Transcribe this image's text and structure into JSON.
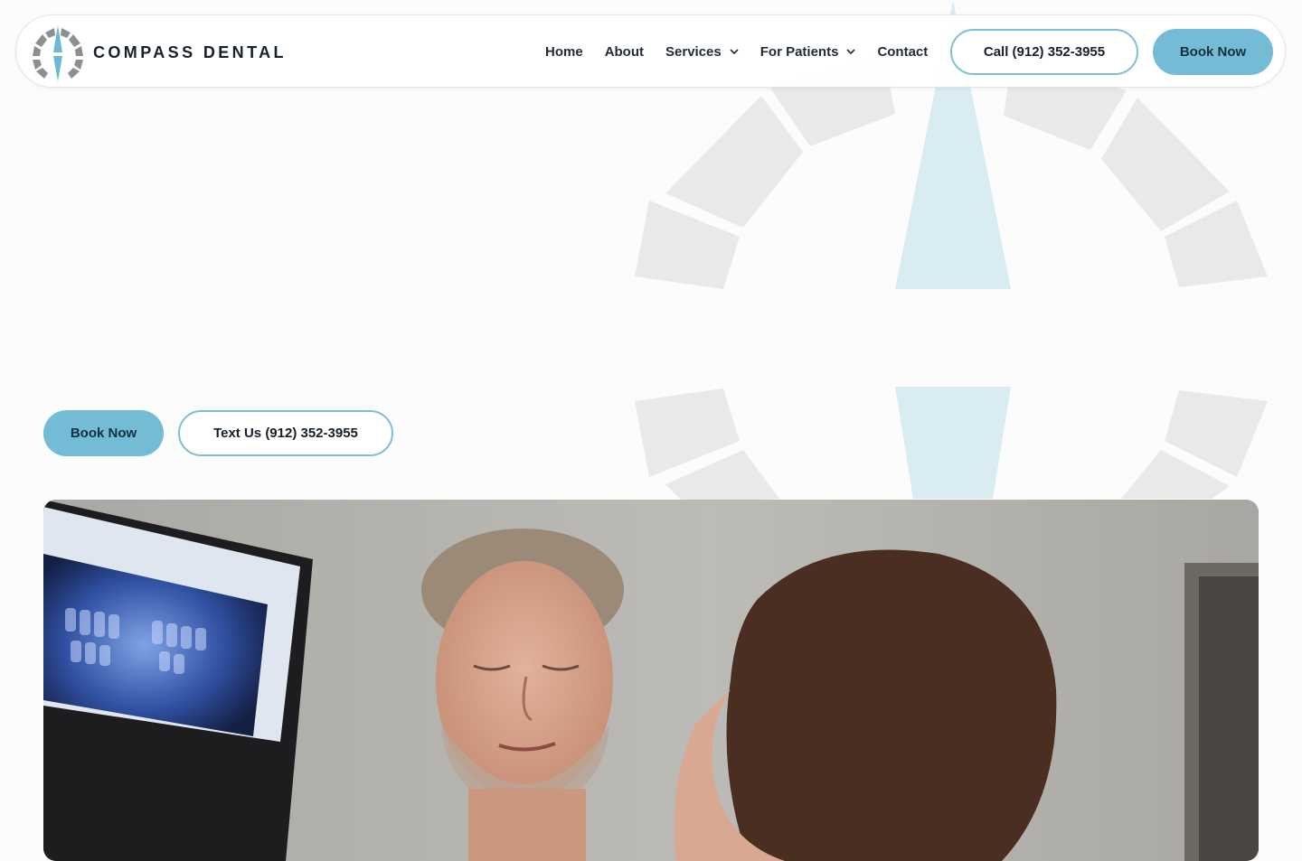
{
  "brand": {
    "name": "COMPASS DENTAL",
    "logo_icon": "compass-logo-icon"
  },
  "nav": {
    "items": [
      {
        "label": "Home",
        "has_dropdown": false
      },
      {
        "label": "About",
        "has_dropdown": false
      },
      {
        "label": "Services",
        "has_dropdown": true
      },
      {
        "label": "For Patients",
        "has_dropdown": true
      },
      {
        "label": "Contact",
        "has_dropdown": false
      }
    ],
    "call_label": "Call (912) 352-3955",
    "book_label": "Book Now"
  },
  "hero": {
    "book_label": "Book Now",
    "text_label": "Text Us (912) 352-3955"
  },
  "colors": {
    "accent": "#74bcd6",
    "accent_outline": "#7ebfd6",
    "text_dark": "#15202a",
    "watermark_gray": "#e9e9e9",
    "watermark_blue": "#d8ecf1"
  }
}
